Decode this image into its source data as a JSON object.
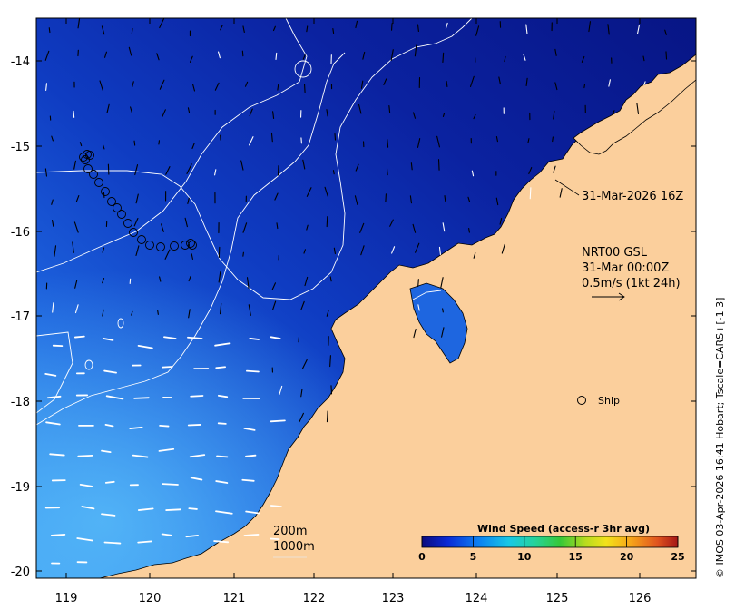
{
  "map": {
    "lon_ticks": [
      "119",
      "120",
      "121",
      "122",
      "123",
      "124",
      "125",
      "126"
    ],
    "lat_ticks": [
      "-14",
      "-15",
      "-16",
      "-17",
      "-18",
      "-19",
      "-20"
    ],
    "colors": {
      "land": "#fbcf9c",
      "ocean_deep": "#0c1a8c",
      "ocean_mid": "#0f3dc8",
      "ocean_light": "#3a86f0",
      "contour": "#ffffff"
    }
  },
  "annotations": {
    "track_time": "31-Mar-2026 16Z",
    "product": "NRT00 GSL",
    "product_time": "31-Mar 00:00Z",
    "scale": "0.5m/s (1kt 24h)",
    "ship": "Ship",
    "contour_200": "200m",
    "contour_1000": "1000m",
    "credit": "© IMOS 03-Apr-2026 16:41 Hobart; Tscale=CARS+[-1 3]"
  },
  "colorbar": {
    "title": "Wind Speed (access-r 3hr avg)",
    "ticks": [
      "0",
      "5",
      "10",
      "15",
      "20",
      "25"
    ],
    "min": 0,
    "max": 25
  }
}
